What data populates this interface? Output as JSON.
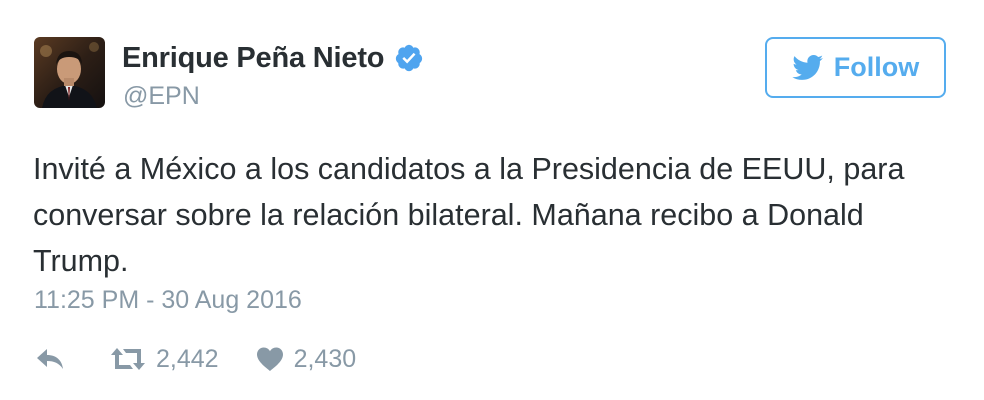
{
  "author": {
    "display_name": "Enrique Peña Nieto",
    "handle": "@EPN",
    "verified": true,
    "avatar": "profile-photo"
  },
  "follow_button": {
    "label": "Follow",
    "icon": "twitter-bird-icon"
  },
  "tweet": {
    "text": "Invité a México a los candidatos a la Presidencia de EEUU, para\nconversar sobre la relación bilateral. Mañana recibo a Donald\nTrump.",
    "timestamp": "11:25 PM - 30 Aug 2016"
  },
  "actions": {
    "reply": {
      "icon": "reply-icon"
    },
    "retweet": {
      "icon": "retweet-icon",
      "count": "2,442"
    },
    "like": {
      "icon": "heart-icon",
      "count": "2,430"
    }
  },
  "colors": {
    "accent": "#55acee",
    "text": "#292f33",
    "muted": "#8899a6",
    "verified_badge": "#4fa4ef"
  }
}
